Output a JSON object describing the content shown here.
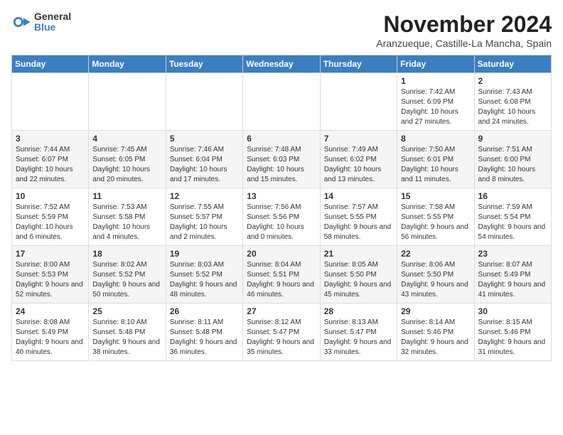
{
  "header": {
    "logo_general": "General",
    "logo_blue": "Blue",
    "month_title": "November 2024",
    "subtitle": "Aranzueque, Castille-La Mancha, Spain"
  },
  "weekdays": [
    "Sunday",
    "Monday",
    "Tuesday",
    "Wednesday",
    "Thursday",
    "Friday",
    "Saturday"
  ],
  "weeks": [
    [
      {
        "day": "",
        "info": ""
      },
      {
        "day": "",
        "info": ""
      },
      {
        "day": "",
        "info": ""
      },
      {
        "day": "",
        "info": ""
      },
      {
        "day": "",
        "info": ""
      },
      {
        "day": "1",
        "info": "Sunrise: 7:42 AM\nSunset: 6:09 PM\nDaylight: 10 hours and 27 minutes."
      },
      {
        "day": "2",
        "info": "Sunrise: 7:43 AM\nSunset: 6:08 PM\nDaylight: 10 hours and 24 minutes."
      }
    ],
    [
      {
        "day": "3",
        "info": "Sunrise: 7:44 AM\nSunset: 6:07 PM\nDaylight: 10 hours and 22 minutes."
      },
      {
        "day": "4",
        "info": "Sunrise: 7:45 AM\nSunset: 6:05 PM\nDaylight: 10 hours and 20 minutes."
      },
      {
        "day": "5",
        "info": "Sunrise: 7:46 AM\nSunset: 6:04 PM\nDaylight: 10 hours and 17 minutes."
      },
      {
        "day": "6",
        "info": "Sunrise: 7:48 AM\nSunset: 6:03 PM\nDaylight: 10 hours and 15 minutes."
      },
      {
        "day": "7",
        "info": "Sunrise: 7:49 AM\nSunset: 6:02 PM\nDaylight: 10 hours and 13 minutes."
      },
      {
        "day": "8",
        "info": "Sunrise: 7:50 AM\nSunset: 6:01 PM\nDaylight: 10 hours and 11 minutes."
      },
      {
        "day": "9",
        "info": "Sunrise: 7:51 AM\nSunset: 6:00 PM\nDaylight: 10 hours and 8 minutes."
      }
    ],
    [
      {
        "day": "10",
        "info": "Sunrise: 7:52 AM\nSunset: 5:59 PM\nDaylight: 10 hours and 6 minutes."
      },
      {
        "day": "11",
        "info": "Sunrise: 7:53 AM\nSunset: 5:58 PM\nDaylight: 10 hours and 4 minutes."
      },
      {
        "day": "12",
        "info": "Sunrise: 7:55 AM\nSunset: 5:57 PM\nDaylight: 10 hours and 2 minutes."
      },
      {
        "day": "13",
        "info": "Sunrise: 7:56 AM\nSunset: 5:56 PM\nDaylight: 10 hours and 0 minutes."
      },
      {
        "day": "14",
        "info": "Sunrise: 7:57 AM\nSunset: 5:55 PM\nDaylight: 9 hours and 58 minutes."
      },
      {
        "day": "15",
        "info": "Sunrise: 7:58 AM\nSunset: 5:55 PM\nDaylight: 9 hours and 56 minutes."
      },
      {
        "day": "16",
        "info": "Sunrise: 7:59 AM\nSunset: 5:54 PM\nDaylight: 9 hours and 54 minutes."
      }
    ],
    [
      {
        "day": "17",
        "info": "Sunrise: 8:00 AM\nSunset: 5:53 PM\nDaylight: 9 hours and 52 minutes."
      },
      {
        "day": "18",
        "info": "Sunrise: 8:02 AM\nSunset: 5:52 PM\nDaylight: 9 hours and 50 minutes."
      },
      {
        "day": "19",
        "info": "Sunrise: 8:03 AM\nSunset: 5:52 PM\nDaylight: 9 hours and 48 minutes."
      },
      {
        "day": "20",
        "info": "Sunrise: 8:04 AM\nSunset: 5:51 PM\nDaylight: 9 hours and 46 minutes."
      },
      {
        "day": "21",
        "info": "Sunrise: 8:05 AM\nSunset: 5:50 PM\nDaylight: 9 hours and 45 minutes."
      },
      {
        "day": "22",
        "info": "Sunrise: 8:06 AM\nSunset: 5:50 PM\nDaylight: 9 hours and 43 minutes."
      },
      {
        "day": "23",
        "info": "Sunrise: 8:07 AM\nSunset: 5:49 PM\nDaylight: 9 hours and 41 minutes."
      }
    ],
    [
      {
        "day": "24",
        "info": "Sunrise: 8:08 AM\nSunset: 5:49 PM\nDaylight: 9 hours and 40 minutes."
      },
      {
        "day": "25",
        "info": "Sunrise: 8:10 AM\nSunset: 5:48 PM\nDaylight: 9 hours and 38 minutes."
      },
      {
        "day": "26",
        "info": "Sunrise: 8:11 AM\nSunset: 5:48 PM\nDaylight: 9 hours and 36 minutes."
      },
      {
        "day": "27",
        "info": "Sunrise: 8:12 AM\nSunset: 5:47 PM\nDaylight: 9 hours and 35 minutes."
      },
      {
        "day": "28",
        "info": "Sunrise: 8:13 AM\nSunset: 5:47 PM\nDaylight: 9 hours and 33 minutes."
      },
      {
        "day": "29",
        "info": "Sunrise: 8:14 AM\nSunset: 5:46 PM\nDaylight: 9 hours and 32 minutes."
      },
      {
        "day": "30",
        "info": "Sunrise: 8:15 AM\nSunset: 5:46 PM\nDaylight: 9 hours and 31 minutes."
      }
    ]
  ]
}
